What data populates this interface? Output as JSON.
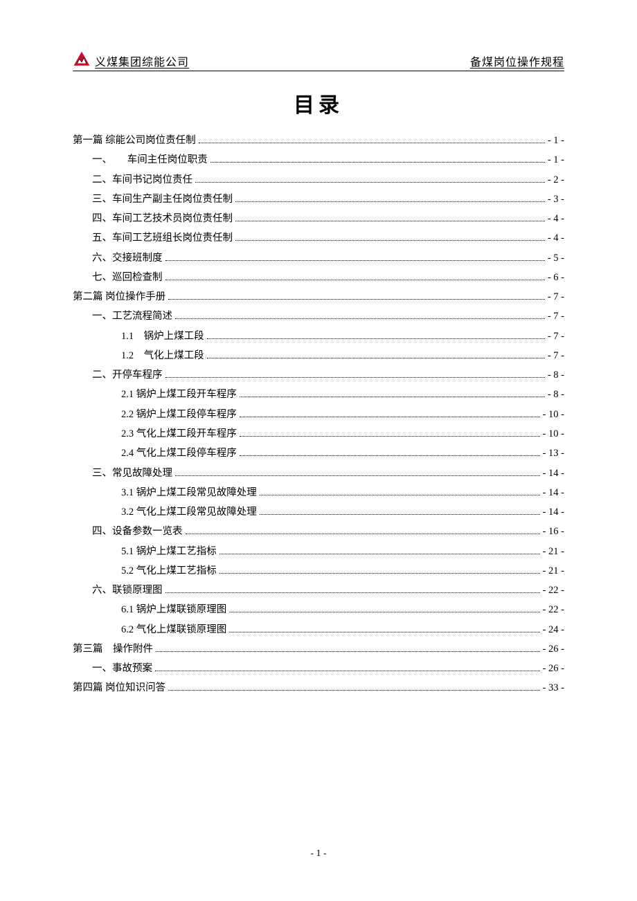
{
  "header": {
    "company": "义煤集团综能公司",
    "doc_title": "备煤岗位操作规程"
  },
  "title": "目录",
  "footer": "- 1 -",
  "toc": [
    {
      "level": 0,
      "label": "第一篇 综能公司岗位责任制",
      "page": "- 1 -"
    },
    {
      "level": 1,
      "label": "一、　　车间主任岗位职责",
      "page": "- 1 -"
    },
    {
      "level": 1,
      "label": "二、车间书记岗位责任",
      "page": "- 2 -"
    },
    {
      "level": 1,
      "label": "三、车间生产副主任岗位责任制",
      "page": "- 3 -"
    },
    {
      "level": 1,
      "label": "四、车间工艺技术员岗位责任制",
      "page": "- 4 -"
    },
    {
      "level": 1,
      "label": "五、车间工艺班组长岗位责任制",
      "page": "- 4 -"
    },
    {
      "level": 1,
      "label": "六、交接班制度",
      "page": "- 5 -"
    },
    {
      "level": 1,
      "label": "七、巡回检查制",
      "page": "- 6 -"
    },
    {
      "level": 0,
      "label": "第二篇 岗位操作手册",
      "page": "- 7 -"
    },
    {
      "level": 1,
      "label": "一、工艺流程简述",
      "page": "- 7 -"
    },
    {
      "level": 2,
      "label": "1.1　锅炉上煤工段",
      "page": "- 7 -"
    },
    {
      "level": 2,
      "label": "1.2　气化上煤工段",
      "page": "- 7 -"
    },
    {
      "level": 1,
      "label": "二、开停车程序",
      "page": "- 8 -"
    },
    {
      "level": 2,
      "label": "2.1 锅炉上煤工段开车程序",
      "page": "- 8 -"
    },
    {
      "level": 2,
      "label": "2.2 锅炉上煤工段停车程序",
      "page": "- 10 -"
    },
    {
      "level": 2,
      "label": "2.3 气化上煤工段开车程序",
      "page": "- 10 -"
    },
    {
      "level": 2,
      "label": "2.4 气化上煤工段停车程序",
      "page": "- 13 -"
    },
    {
      "level": 1,
      "label": "三、常见故障处理",
      "page": "- 14 -"
    },
    {
      "level": 2,
      "label": "3.1 锅炉上煤工段常见故障处理",
      "page": "- 14 -"
    },
    {
      "level": 2,
      "label": "3.2 气化上煤工段常见故障处理",
      "page": "- 14 -"
    },
    {
      "level": 1,
      "label": "四、设备参数一览表",
      "page": "- 16 -"
    },
    {
      "level": 2,
      "label": "5.1 锅炉上煤工艺指标",
      "page": "- 21 -"
    },
    {
      "level": 2,
      "label": "5.2 气化上煤工艺指标",
      "page": "- 21 -"
    },
    {
      "level": 1,
      "label": "六、联锁原理图",
      "page": "- 22 -"
    },
    {
      "level": 2,
      "label": "6.1 锅炉上煤联锁原理图",
      "page": "- 22 -"
    },
    {
      "level": 2,
      "label": "6.2 气化上煤联锁原理图",
      "page": "- 24 -"
    },
    {
      "level": 0,
      "label": "第三篇　操作附件",
      "page": "- 26 -"
    },
    {
      "level": 1,
      "label": "一、事故预案",
      "page": "- 26 -"
    },
    {
      "level": 0,
      "label": "第四篇 岗位知识问答",
      "page": "- 33 -"
    }
  ]
}
